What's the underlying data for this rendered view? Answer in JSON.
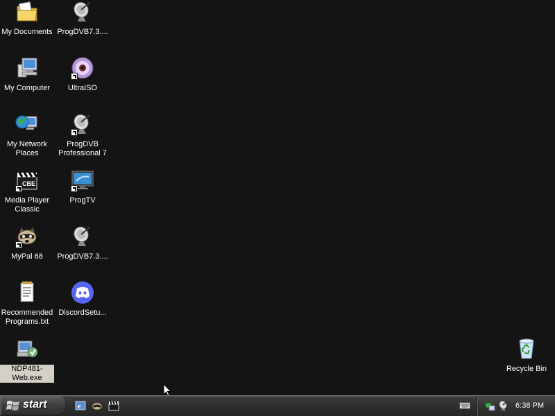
{
  "desktop": {
    "icons": [
      {
        "label": "My Documents"
      },
      {
        "label": "My Computer"
      },
      {
        "label": "My Network Places"
      },
      {
        "label": "Media Player Classic"
      },
      {
        "label": "MyPal 68"
      },
      {
        "label": "Recommended Programs.txt"
      },
      {
        "label": "NDP481-Web.exe"
      },
      {
        "label": "ProgDVB7.3...."
      },
      {
        "label": "UltraISO"
      },
      {
        "label": "ProgDVB Professional 7"
      },
      {
        "label": "ProgTV"
      },
      {
        "label": "ProgDVB7.3...."
      },
      {
        "label": "DiscordSetu..."
      },
      {
        "label": "Recycle Bin"
      }
    ]
  },
  "taskbar": {
    "start_label": "start",
    "clock": "6:38 PM"
  },
  "colors": {
    "desktop_bg": "#141414",
    "taskbar": "#2e2e2e",
    "selection": "#d4d0c8"
  }
}
